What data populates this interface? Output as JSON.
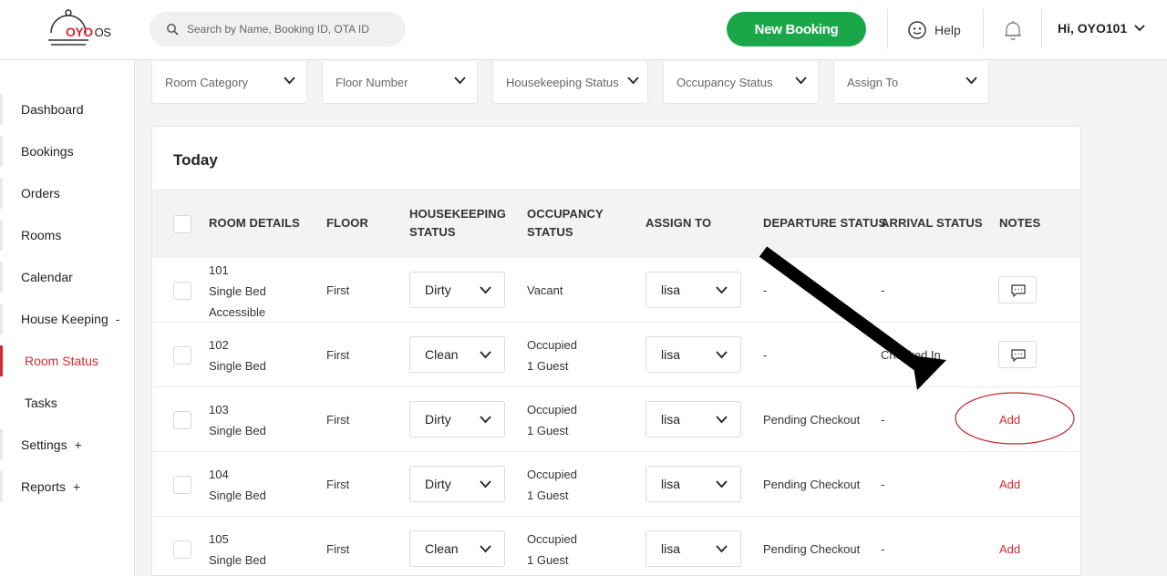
{
  "header": {
    "logo_text": "OYO",
    "logo_suffix": "OS",
    "search_placeholder": "Search by Name, Booking ID, OTA ID",
    "new_booking_label": "New Booking",
    "help_label": "Help",
    "user_label": "Hi, OYO101"
  },
  "sidebar": {
    "items": [
      {
        "label": "Dashboard"
      },
      {
        "label": "Bookings"
      },
      {
        "label": "Orders"
      },
      {
        "label": "Rooms"
      },
      {
        "label": "Calendar"
      },
      {
        "label": "House Keeping",
        "symbol": "-"
      },
      {
        "label": "Room Status"
      },
      {
        "label": "Tasks"
      },
      {
        "label": "Settings",
        "symbol": "+"
      },
      {
        "label": "Reports",
        "symbol": "+"
      }
    ]
  },
  "filters": [
    {
      "label": "Room Category"
    },
    {
      "label": "Floor Number"
    },
    {
      "label": "Housekeeping Status"
    },
    {
      "label": "Occupancy Status"
    },
    {
      "label": "Assign To"
    }
  ],
  "table": {
    "title": "Today",
    "columns": {
      "room_details": "ROOM DETAILS",
      "floor": "FLOOR",
      "housekeeping_1": "HOUSEKEEPING",
      "housekeeping_2": "STATUS",
      "occupancy_1": "OCCUPANCY",
      "occupancy_2": "STATUS",
      "assign_to": "ASSIGN TO",
      "departure": "DEPARTURE STATUS",
      "arrival": "ARRIVAL STATUS",
      "notes": "NOTES"
    },
    "rows": [
      {
        "room": "101",
        "type": "Single Bed",
        "extra": "Accessible",
        "floor": "First",
        "housekeeping": "Dirty",
        "occupancy": "Vacant",
        "occupancy_guests": "",
        "assign": "lisa",
        "departure": "-",
        "arrival": "-",
        "notes": "",
        "notes_icon": "comment-icon"
      },
      {
        "room": "102",
        "type": "Single Bed",
        "extra": "",
        "floor": "First",
        "housekeeping": "Clean",
        "occupancy": "Occupied",
        "occupancy_guests": "1 Guest",
        "assign": "lisa",
        "departure": "-",
        "arrival": "Checked In",
        "notes": "",
        "notes_icon": "comment-icon"
      },
      {
        "room": "103",
        "type": "Single Bed",
        "extra": "",
        "floor": "First",
        "housekeeping": "Dirty",
        "occupancy": "Occupied",
        "occupancy_guests": "1 Guest",
        "assign": "lisa",
        "departure": "Pending Checkout",
        "arrival": "-",
        "notes": "Add"
      },
      {
        "room": "104",
        "type": "Single Bed",
        "extra": "",
        "floor": "First",
        "housekeeping": "Dirty",
        "occupancy": "Occupied",
        "occupancy_guests": "1 Guest",
        "assign": "lisa",
        "departure": "Pending Checkout",
        "arrival": "-",
        "notes": "Add"
      },
      {
        "room": "105",
        "type": "Single Bed",
        "extra": "",
        "floor": "First",
        "housekeeping": "Clean",
        "occupancy": "Occupied",
        "occupancy_guests": "1 Guest",
        "assign": "lisa",
        "departure": "Pending Checkout",
        "arrival": "-",
        "notes": "Add"
      }
    ]
  },
  "colors": {
    "brand": "#d7282f",
    "primary_button": "#1aa74a",
    "annotation": "#000000"
  },
  "annotations": {
    "arrow_icon": "arrow-icon",
    "highlight_icon": "highlight-ellipse-icon"
  }
}
